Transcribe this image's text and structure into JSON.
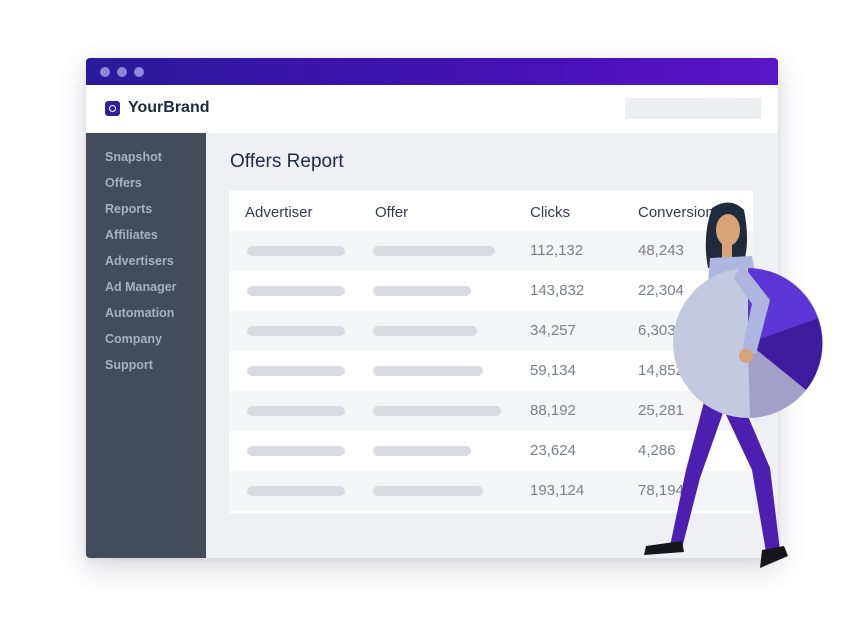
{
  "window": {
    "controls": [
      "close",
      "minimize",
      "maximize"
    ]
  },
  "header": {
    "brand": "YourBrand",
    "logo_icon": "brand-logo-icon"
  },
  "sidebar": {
    "items": [
      {
        "label": "Snapshot"
      },
      {
        "label": "Offers"
      },
      {
        "label": "Reports"
      },
      {
        "label": "Affiliates"
      },
      {
        "label": "Advertisers"
      },
      {
        "label": "Ad Manager"
      },
      {
        "label": "Automation"
      },
      {
        "label": "Company"
      },
      {
        "label": "Support"
      }
    ]
  },
  "main": {
    "title": "Offers Report",
    "table": {
      "headers": [
        "Advertiser",
        "Offer",
        "Clicks",
        "Conversions"
      ],
      "rows": [
        {
          "clicks": "112,132",
          "conversions": "48,243"
        },
        {
          "clicks": "143,832",
          "conversions": "22,304"
        },
        {
          "clicks": "34,257",
          "conversions": "6,303"
        },
        {
          "clicks": "59,134",
          "conversions": "14,852"
        },
        {
          "clicks": "88,192",
          "conversions": "25,281"
        },
        {
          "clicks": "23,624",
          "conversions": "4,286"
        },
        {
          "clicks": "193,124",
          "conversions": "78,194"
        }
      ]
    }
  },
  "colors": {
    "titlebar_start": "#2a1a9a",
    "titlebar_end": "#5a15c8",
    "sidebar": "#444c5c",
    "brand": "#2f1fa0",
    "pie_main": "#c5c9e0",
    "pie_accent_1": "#5b35d5",
    "pie_accent_2": "#3d1ca0",
    "pie_accent_3": "#a29fc8"
  }
}
